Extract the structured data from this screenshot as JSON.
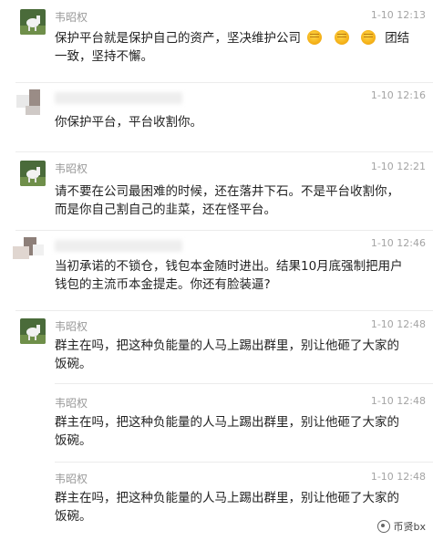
{
  "messages": [
    {
      "sender": "韦昭权",
      "time": "1-10 12:13",
      "line1_prefix": "保护平台就是保护自己的资产，坚决维护公司",
      "line1_suffix": "团结",
      "line2": "一致，坚持不懈。",
      "emoji": "fist-emoji"
    },
    {
      "sender_blurred": true,
      "time": "1-10 12:16",
      "text": "你保护平台，平台收割你。"
    },
    {
      "sender": "韦昭权",
      "time": "1-10 12:21",
      "line1": "请不要在公司最困难的时候，还在落井下石。不是平台收割你，",
      "line2": "而是你自己割自己的韭菜，还在怪平台。"
    },
    {
      "sender_blurred": true,
      "time": "1-10 12:46",
      "line1": "当初承诺的不锁仓，钱包本金随时进出。结果10月底强制把用户",
      "line2": "钱包的主流币本金提走。你还有脸装逼?"
    },
    {
      "sender": "韦昭权",
      "time": "1-10 12:48",
      "line1": "群主在吗，把这种负能量的人马上踢出群里，别让他砸了大家的",
      "line2": "饭碗。"
    },
    {
      "sender": "韦昭权",
      "time": "1-10 12:48",
      "line1": "群主在吗，把这种负能量的人马上踢出群里，别让他砸了大家的",
      "line2": "饭碗。"
    },
    {
      "sender": "韦昭权",
      "time": "1-10 12:48",
      "line1": "群主在吗，把这种负能量的人马上踢出群里，别让他砸了大家的",
      "line2": "饭碗。"
    }
  ],
  "watermark": {
    "text": "币贤bx"
  }
}
